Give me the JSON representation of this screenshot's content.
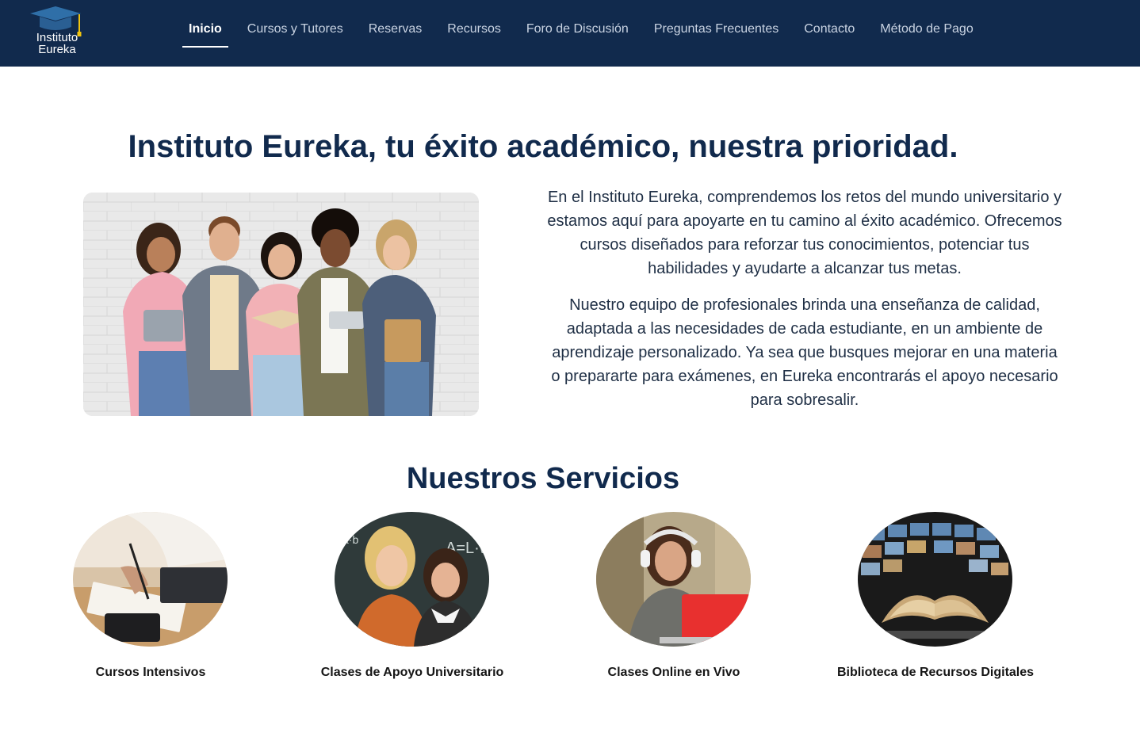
{
  "brand": {
    "logo_line1": "Instituto",
    "logo_line2": "Eureka",
    "primary_color": "#112a4d",
    "accent_color": "#f1c40f"
  },
  "nav": {
    "items": [
      {
        "label": "Inicio",
        "active": true
      },
      {
        "label": "Cursos y Tutores"
      },
      {
        "label": "Reservas"
      },
      {
        "label": "Recursos"
      },
      {
        "label": "Foro de Discusión"
      },
      {
        "label": "Preguntas Frecuentes"
      },
      {
        "label": "Contacto"
      },
      {
        "label": "Método de Pago"
      }
    ]
  },
  "hero": {
    "title": "Instituto Eureka, tu éxito académico, nuestra prioridad.",
    "paragraph1": "En el Instituto Eureka, comprendemos los retos del mundo universitario y estamos aquí para apoyarte en tu camino al éxito académico. Ofrecemos cursos diseñados para reforzar tus conocimientos, potenciar tus habilidades y ayudarte a alcanzar tus metas.",
    "paragraph2": "Nuestro equipo de profesionales brinda una enseñanza de calidad, adaptada a las necesidades de cada estudiante, en un ambiente de aprendizaje personalizado. Ya sea que busques mejorar en una materia o prepararte para exámenes, en Eureka encontrarás el apoyo necesario para sobresalir.",
    "image": "students-group-photo"
  },
  "services": {
    "title": "Nuestros Servicios",
    "items": [
      {
        "label": "Cursos Intensivos",
        "image": "person-writing-notebook"
      },
      {
        "label": "Clases de Apoyo Universitario",
        "image": "two-students-chalkboard"
      },
      {
        "label": "Clases Online en Vivo",
        "image": "woman-headphones-laptop"
      },
      {
        "label": "Biblioteca de Recursos Digitales",
        "image": "open-book-digital-screens"
      }
    ]
  }
}
